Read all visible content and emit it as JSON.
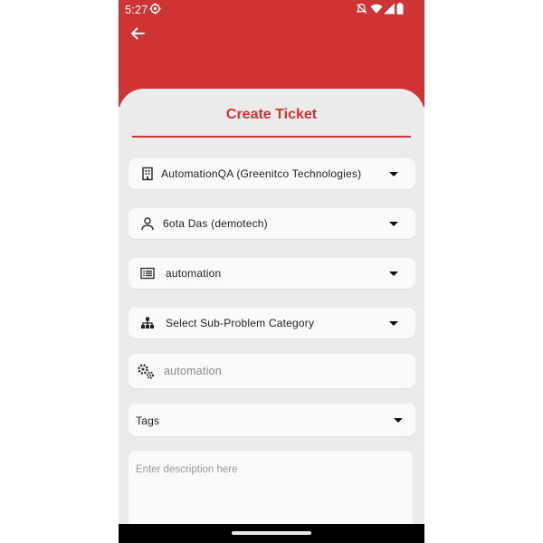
{
  "status_bar": {
    "time": "5:27",
    "icons": [
      "settings-gear-icon",
      "mute-icon",
      "wifi-icon",
      "signal-icon",
      "battery-icon"
    ]
  },
  "app_bar": {
    "back_icon": "arrow-back-icon",
    "color": "#d03333"
  },
  "form": {
    "title": "Create Ticket",
    "company": {
      "icon": "building-icon",
      "value": "AutomationQA (Greenitco Technologies)"
    },
    "user": {
      "icon": "person-icon",
      "value": "6ota Das (demotech)"
    },
    "problem_category": {
      "icon": "list-icon",
      "value": "automation"
    },
    "sub_problem_category": {
      "icon": "hierarchy-icon",
      "value": "Select Sub-Problem Category"
    },
    "product": {
      "icon": "gears-icon",
      "value": "automation"
    },
    "tags": {
      "label": "Tags"
    },
    "description": {
      "placeholder": "Enter description here"
    }
  },
  "colors": {
    "accent": "#d03333",
    "background": "#ebebeb",
    "field": "#fafafa"
  }
}
